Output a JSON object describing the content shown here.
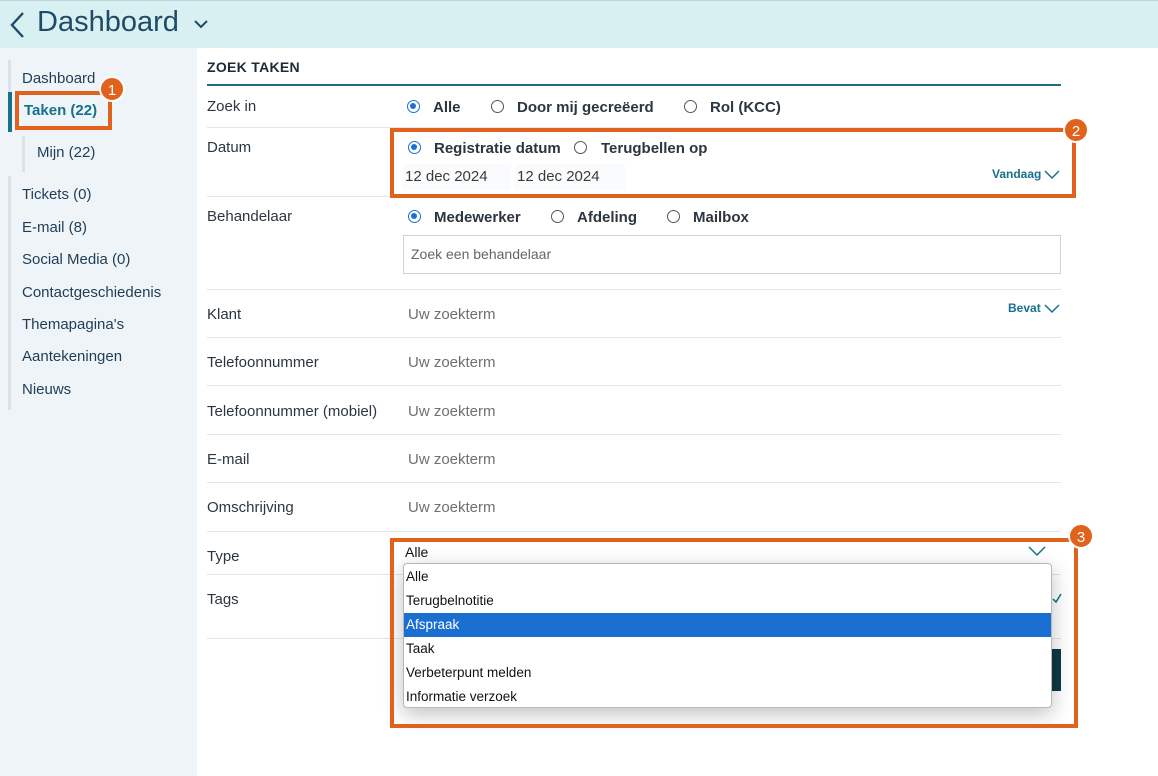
{
  "header": {
    "title": "Dashboard"
  },
  "sidebar": {
    "items": [
      {
        "label": "Dashboard"
      },
      {
        "label": "Taken (22)"
      },
      {
        "label": "Mijn (22)"
      },
      {
        "label": "Tickets (0)"
      },
      {
        "label": "E-mail (8)"
      },
      {
        "label": "Social Media (0)"
      },
      {
        "label": "Contactgeschiedenis"
      },
      {
        "label": "Themapagina's"
      },
      {
        "label": "Aantekeningen"
      },
      {
        "label": "Nieuws"
      }
    ],
    "active_item": "Taken (22)"
  },
  "callouts": [
    "1",
    "2",
    "3"
  ],
  "form": {
    "section_title": "ZOEK TAKEN",
    "zoek_in": {
      "label": "Zoek in",
      "options": [
        "Alle",
        "Door mij gecreëerd",
        "Rol (KCC)"
      ],
      "selected": "Alle"
    },
    "datum": {
      "label": "Datum",
      "options": [
        "Registratie datum",
        "Terugbellen op"
      ],
      "selected": "Registratie datum",
      "from": "12 dec 2024",
      "to": "12 dec 2024",
      "preset": "Vandaag"
    },
    "behandelaar": {
      "label": "Behandelaar",
      "options": [
        "Medewerker",
        "Afdeling",
        "Mailbox"
      ],
      "selected": "Medewerker",
      "placeholder": "Zoek een behandelaar"
    },
    "klant": {
      "label": "Klant",
      "placeholder": "Uw zoekterm",
      "match": "Bevat"
    },
    "telefoonnummer": {
      "label": "Telefoonnummer",
      "placeholder": "Uw zoekterm"
    },
    "telefoonnummer_mobiel": {
      "label": "Telefoonnummer (mobiel)",
      "placeholder": "Uw zoekterm"
    },
    "email": {
      "label": "E-mail",
      "placeholder": "Uw zoekterm"
    },
    "omschrijving": {
      "label": "Omschrijving",
      "placeholder": "Uw zoekterm"
    },
    "type": {
      "label": "Type",
      "value": "Alle",
      "options": [
        "Alle",
        "Terugbelnotitie",
        "Afspraak",
        "Taak",
        "Verbeterpunt melden",
        "Informatie verzoek"
      ],
      "highlighted": "Afspraak"
    },
    "tags": {
      "label": "Tags"
    }
  },
  "colors": {
    "header_bg": "#d9f0f3",
    "sidebar_bg": "#eef4f8",
    "accent": "#17708c",
    "callout": "#e0621c",
    "radio": "#1d6fd6",
    "dropdown_highlight": "#1b6fd0"
  }
}
